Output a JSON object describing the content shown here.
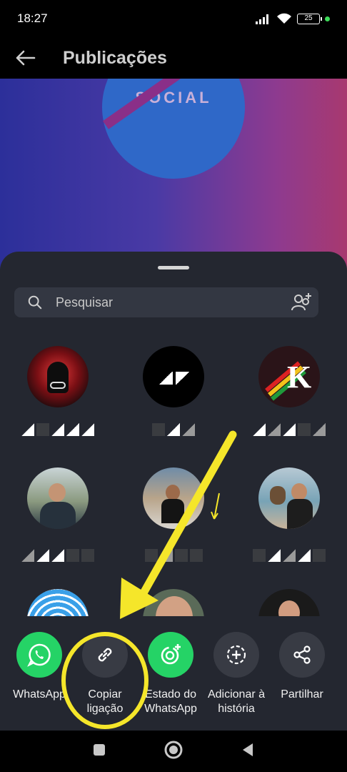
{
  "status_bar": {
    "time": "18:27",
    "battery": "25"
  },
  "app_bar": {
    "title": "Publicações"
  },
  "post": {
    "logo_text": "SOCIAL"
  },
  "search": {
    "placeholder": "Pesquisar"
  },
  "apps": [
    {
      "label": "WhatsApp",
      "icon": "whatsapp-icon"
    },
    {
      "label": "Copiar ligação",
      "icon": "link-icon"
    },
    {
      "label": "Estado do WhatsApp",
      "icon": "whatsapp-status-icon"
    },
    {
      "label": "Adicionar à história",
      "icon": "add-story-icon"
    },
    {
      "label": "Partilhar",
      "icon": "share-icon"
    }
  ],
  "colors": {
    "sheet": "#242730",
    "whatsapp_green": "#25d366",
    "annotation_yellow": "#f5e62a"
  }
}
